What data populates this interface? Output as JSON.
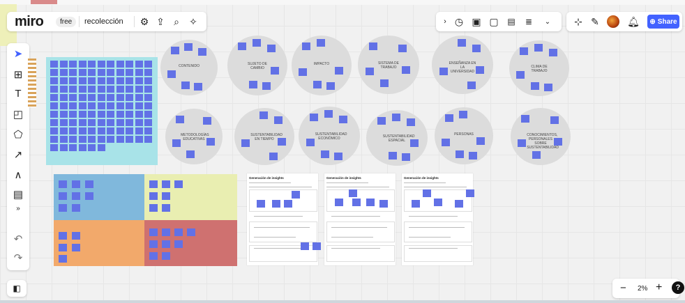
{
  "toolbar": {
    "logo": "miro",
    "plan_badge": "free",
    "board_name": "recolección",
    "share_label": "Share",
    "icons_left": [
      "gear-icon",
      "upload-icon",
      "search-icon",
      "magic-icon"
    ],
    "icons_right": [
      "chevron-right-icon",
      "timer-icon",
      "present-icon",
      "comment-icon",
      "board-icon",
      "notes-icon",
      "more-icon"
    ],
    "icons_collab": [
      "reaction-icon",
      "cursor-icon",
      "avatar",
      "bell-icon"
    ]
  },
  "left_tools": [
    "select-icon",
    "frame-icon",
    "text-icon",
    "sticky-icon",
    "shapes-icon",
    "pen-icon",
    "draw-icon",
    "comment-icon",
    "more-icon",
    "undo-icon",
    "redo-icon"
  ],
  "zoom": {
    "minus": "−",
    "value": "2%",
    "plus": "+",
    "help": "?"
  },
  "board": {
    "circles_row1": [
      "CONTENIDO",
      "SUJETO DE CAMBIO",
      "IMPACTO",
      "SISTEMA DE TRABAJO",
      "ENSEÑANZA EN LA UNIVERSIDAD",
      "CLIMA DE TRABAJO"
    ],
    "circles_row2": [
      "METODOLOGÍAS EDUCATIVAS",
      "SUSTENTABILIDAD EN TIEMPO",
      "SUSTENTABILIDAD ECONÓMICO",
      "SUSTENTABILIDAD ESPACIAL",
      "PERSONAS",
      "CONOCIMIENTOS, PERSONALES SOBRE SUSTENTABILIDAD"
    ],
    "cards": [
      {
        "title": "Generación de insights"
      },
      {
        "title": "Generación de insights"
      },
      {
        "title": "Generación de insights"
      }
    ]
  },
  "colors": {
    "accent": "#4262ff",
    "sticky": "#6271e6",
    "frame_cyan": "#a8e3e8"
  }
}
